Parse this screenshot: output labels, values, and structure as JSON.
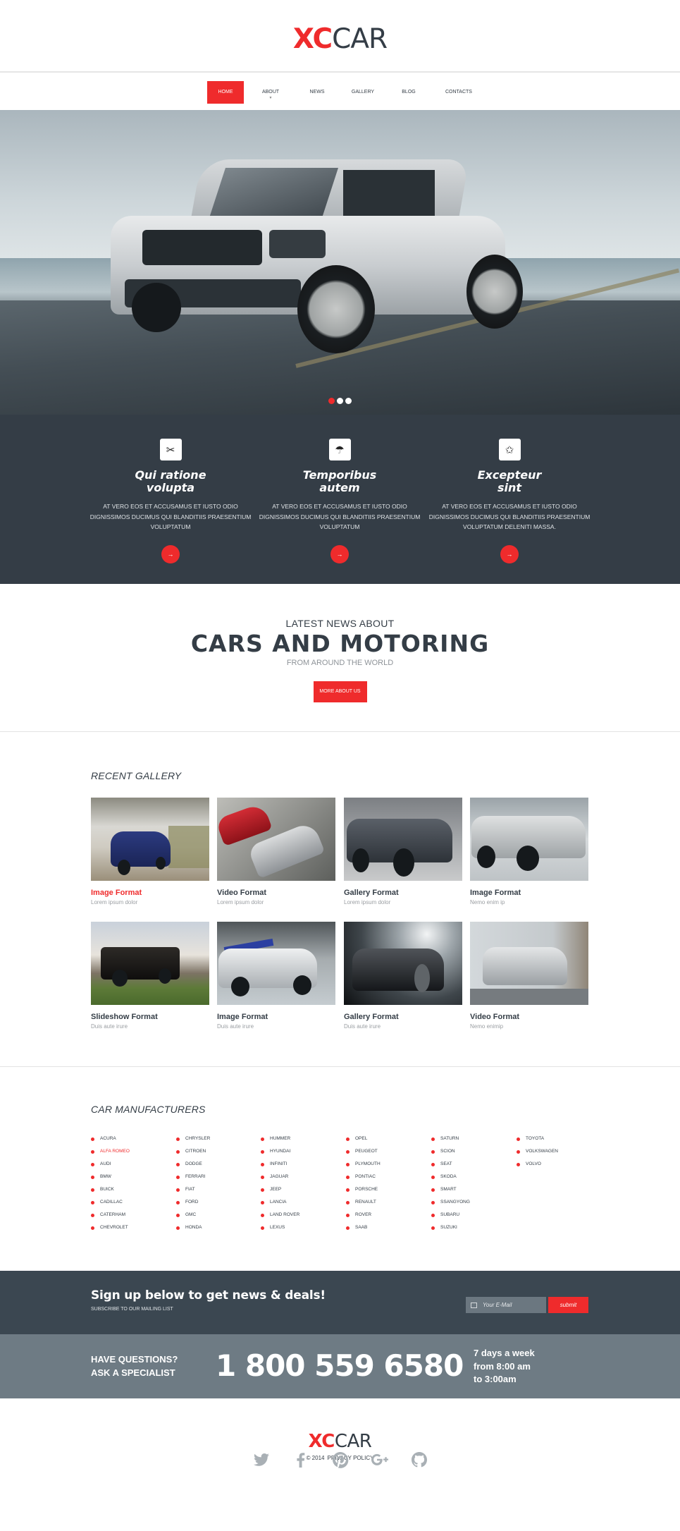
{
  "header": {
    "logo": {
      "part1": "XC",
      "part2": "CAR"
    }
  },
  "nav": {
    "items": [
      {
        "label": "HOME",
        "active": true
      },
      {
        "label": "ABOUT",
        "has_dropdown": true
      },
      {
        "label": "NEWS"
      },
      {
        "label": "GALLERY"
      },
      {
        "label": "BLOG"
      },
      {
        "label": "CONTACTS"
      }
    ]
  },
  "hero": {
    "slides": 3,
    "active_slide": 1
  },
  "features": [
    {
      "icon": "tools-icon",
      "glyph": "✂",
      "title_line1": "Qui ratione",
      "title_line2": "volupta",
      "text": "AT VERO EOS ET ACCUSAMUS ET IUSTO ODIO DIGNISSIMOS DUCIMUS QUI BLANDITIIS PRAESENTIUM VOLUPTATUM",
      "arrow": "→"
    },
    {
      "icon": "umbrella-icon",
      "glyph": "☂",
      "title_line1": "Temporibus",
      "title_line2": "autem",
      "text": "AT VERO EOS ET ACCUSAMUS ET IUSTO ODIO DIGNISSIMOS DUCIMUS QUI BLANDITIIS PRAESENTIUM VOLUPTATUM",
      "arrow": "→"
    },
    {
      "icon": "star-icon",
      "glyph": "✩",
      "title_line1": "Excepteur",
      "title_line2": "sint",
      "text": "AT VERO EOS ET ACCUSAMUS ET IUSTO ODIO DIGNISSIMOS DUCIMUS QUI BLANDITIIS PRAESENTIUM VOLUPTATUM DELENITI  MASSA.",
      "arrow": "→"
    }
  ],
  "news": {
    "subtitle_top": "LATEST NEWS ABOUT",
    "title": "CARS AND MOTORING",
    "subtitle_bottom": "FROM AROUND THE WORLD",
    "button_label": "MORE ABOUT US"
  },
  "gallery": {
    "title": "RECENT GALLERY",
    "items": [
      {
        "title": "Image Format",
        "desc": "Lorem ipsum dolor",
        "highlight": true
      },
      {
        "title": "Video Format",
        "desc": "Lorem ipsum dolor"
      },
      {
        "title": "Gallery Format",
        "desc": "Lorem ipsum dolor"
      },
      {
        "title": "Image Format",
        "desc": "Nemo enim ip"
      },
      {
        "title": "Slideshow Format",
        "desc": "Duis aute irure"
      },
      {
        "title": "Image Format",
        "desc": "Duis aute irure"
      },
      {
        "title": "Gallery Format",
        "desc": "Duis aute irure"
      },
      {
        "title": "Video Format",
        "desc": "Nemo enimip"
      }
    ]
  },
  "manufacturers": {
    "title": "CAR MANUFACTURERS",
    "highlighted": "ALFA ROMEO",
    "columns": [
      [
        "ACURA",
        "ALFA ROMEO",
        "AUDI",
        "BMW",
        "BUICK",
        "CADILLAC",
        "CATERHAM",
        "CHEVROLET"
      ],
      [
        "CHRYSLER",
        "CITROEN",
        "DODGE",
        "FERRARI",
        "FIAT",
        "FORD",
        "GMC",
        "HONDA"
      ],
      [
        "HUMMER",
        "HYUNDAI",
        "INFINITI",
        "JAGUAR",
        "JEEP",
        "LANCIA",
        "LAND ROVER",
        "LEXUS"
      ],
      [
        "OPEL",
        "PEUGEOT",
        "PLYMOUTH",
        "PONTIAC",
        "PORSCHE",
        "RENAULT",
        "ROVER",
        "SAAB"
      ],
      [
        "SATURN",
        "SCION",
        "SEAT",
        "SKODA",
        "SMART",
        "SSANGYONG",
        "SUBARU",
        "SUZUKI"
      ],
      [
        "TOYOTA",
        "VOLKSWAGEN",
        "VOLVO"
      ]
    ]
  },
  "subscribe": {
    "heading": "Sign up below to get news & deals!",
    "subheading": "SUBSCRIBE TO OUR MAILING LIST",
    "email_placeholder": "Your E-Mail",
    "email_value": "",
    "submit_label": "submit"
  },
  "contact": {
    "question_line1": "HAVE QUESTIONS?",
    "question_line2": "ASK A SPECIALIST",
    "phone": "1 800 559 6580",
    "hours_line1": "7 days a week",
    "hours_line2": "from 8:00 am",
    "hours_line3": "to 3:00am"
  },
  "footer": {
    "logo": {
      "part1": "XC",
      "part2": "CAR"
    },
    "copyright": "© 2014",
    "privacy_label": "PRIVACY POLICY",
    "socials": [
      "twitter",
      "facebook",
      "pinterest",
      "google-plus",
      "github"
    ]
  },
  "colors": {
    "accent": "#ef2b2c",
    "dark": "#343d46",
    "slate": "#6e7b84"
  }
}
